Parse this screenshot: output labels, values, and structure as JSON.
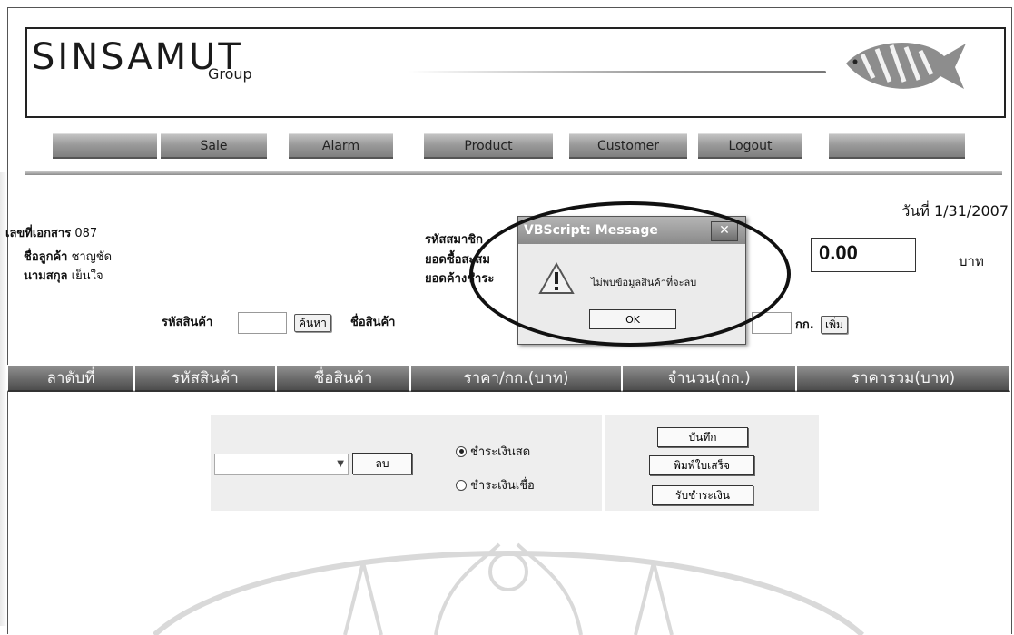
{
  "header": {
    "logo": "SINSAMUT",
    "logo_sub": "Group"
  },
  "nav": {
    "items": [
      "",
      "Sale",
      "Alarm",
      "Product",
      "Customer",
      "Logout",
      ""
    ]
  },
  "date": {
    "label": "วันที่",
    "value": "1/31/2007"
  },
  "info": {
    "doc_label": "เลขที่เอกสาร",
    "doc_value": "087",
    "cust_label": "ชื่อลูกค้า",
    "cust_value": "ชาญชัด",
    "surname_label": "นามสกุล",
    "surname_value": "เย็นใจ",
    "member_label": "รหัสสมาชิก",
    "purchase_label": "ยอดซื้อสะสม",
    "outstanding_label": "ยอดค้างชำระ",
    "amount": "0.00",
    "currency": "บาท"
  },
  "product": {
    "code_label": "รหัสสินค้า",
    "search_button": "ค้นหา",
    "name_label": "ชื่อสินค้า",
    "unit": "กก.",
    "add_button": "เพิ่ม"
  },
  "table": {
    "headers": [
      "ลาดับที่",
      "รหัสสินค้า",
      "ชื่อสินค้า",
      "ราคา/กก.(บาท)",
      "จำนวน(กก.)",
      "ราคารวม(บาท)"
    ]
  },
  "payment": {
    "delete_button": "ลบ",
    "cash_label": "ชำระเงินสด",
    "credit_label": "ชำระเงินเชื่อ",
    "cash_selected": true,
    "save_button": "บันทึก",
    "print_button": "พิมพ์ใบเสร็จ",
    "receive_button": "รับชำระเงิน"
  },
  "dialog": {
    "title": "VBScript: Message",
    "message": "ไม่พบข้อมูลสินค้าที่จะลบ",
    "ok_button": "OK",
    "close": "✕"
  }
}
